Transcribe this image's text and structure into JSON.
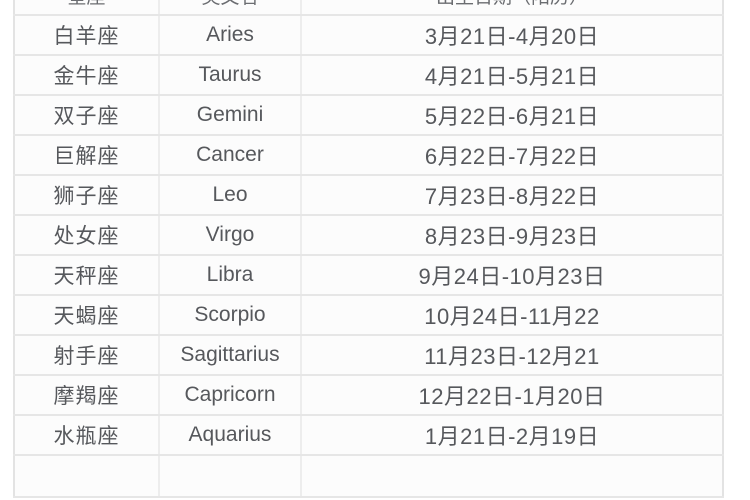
{
  "table": {
    "columns": [
      {
        "key": "cn",
        "label": "星座"
      },
      {
        "key": "en",
        "label": "英文名"
      },
      {
        "key": "date",
        "label": "出生日期（阳历）"
      }
    ],
    "rows": [
      {
        "cn": "白羊座",
        "en": "Aries",
        "date": "3月21日-4月20日"
      },
      {
        "cn": "金牛座",
        "en": "Taurus",
        "date": "4月21日-5月21日"
      },
      {
        "cn": "双子座",
        "en": "Gemini",
        "date": "5月22日-6月21日"
      },
      {
        "cn": "巨解座",
        "en": "Cancer",
        "date": "6月22日-7月22日"
      },
      {
        "cn": "狮子座",
        "en": "Leo",
        "date": "7月23日-8月22日"
      },
      {
        "cn": "处女座",
        "en": "Virgo",
        "date": "8月23日-9月23日"
      },
      {
        "cn": "天秤座",
        "en": "Libra",
        "date": "9月24日-10月23日"
      },
      {
        "cn": "天蝎座",
        "en": "Scorpio",
        "date": "10月24日-11月22"
      },
      {
        "cn": "射手座",
        "en": "Sagittarius",
        "date": "11月23日-12月21"
      },
      {
        "cn": "摩羯座",
        "en": "Capricorn",
        "date": "12月22日-1月20日"
      },
      {
        "cn": "水瓶座",
        "en": "Aquarius",
        "date": "1月21日-2月19日"
      },
      {
        "cn": "",
        "en": "",
        "date": ""
      }
    ]
  },
  "colors": {
    "text": "#56585c",
    "border": "#e6e6e6",
    "cell_background": "#fcfcfc",
    "page_background": "#ffffff"
  }
}
